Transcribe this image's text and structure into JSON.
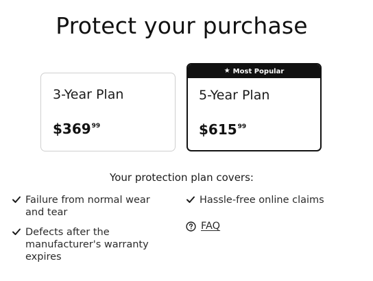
{
  "title": "Protect your purchase",
  "plans": [
    {
      "name": "3-Year Plan",
      "price_main": "$369",
      "price_cents": "99",
      "badge": null,
      "selected": false
    },
    {
      "name": "5-Year Plan",
      "price_main": "$615",
      "price_cents": "99",
      "badge": "Most Popular",
      "selected": true
    }
  ],
  "covers": {
    "title": "Your protection plan covers:",
    "items": [
      "Failure from normal wear and tear",
      "Defects after the manufacturer's warranty expires",
      "Hassle-free online claims"
    ]
  },
  "faq": {
    "label": "FAQ",
    "icon": "question-circle-icon"
  },
  "colors": {
    "text": "#1a1a1a",
    "selected_border": "#111111",
    "unselected_border": "#cfcfcf",
    "badge_bg": "#111111",
    "badge_text": "#ffffff"
  }
}
